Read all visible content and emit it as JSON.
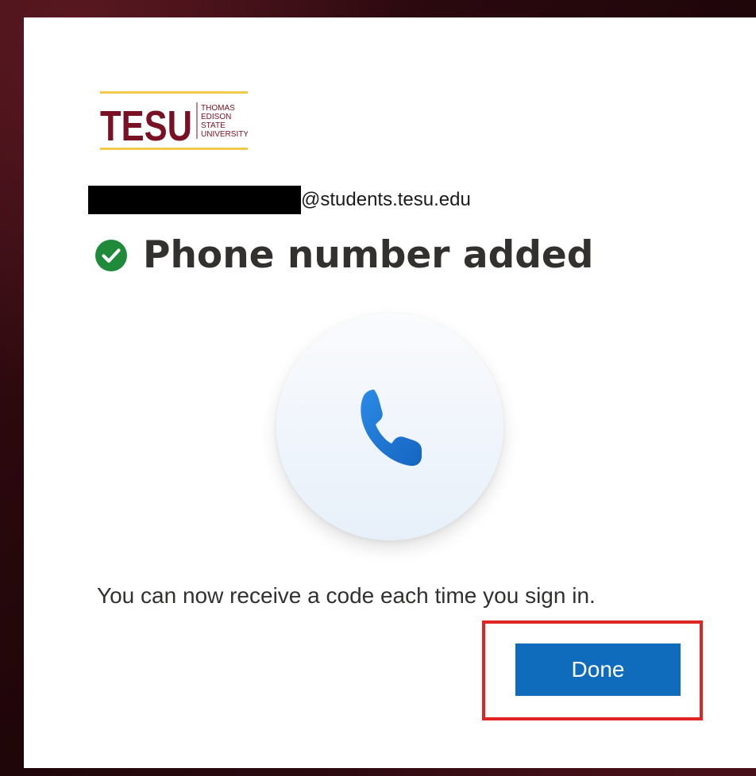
{
  "dialog": {
    "logo": {
      "wordmark": "TESU",
      "name_lines": [
        "THOMAS",
        "EDISON",
        "STATE",
        "UNIVERSITY"
      ],
      "accent_color": "#f2c94c",
      "brand_color": "#7a1023"
    },
    "account": {
      "email_suffix": "@students.tesu.edu"
    },
    "title": "Phone number added",
    "status_color": "#1e8a3a",
    "message": "You can now receive a code each time you sign in.",
    "done_label": "Done",
    "button_color": "#0f6cbd",
    "highlight_color": "#e02424"
  }
}
